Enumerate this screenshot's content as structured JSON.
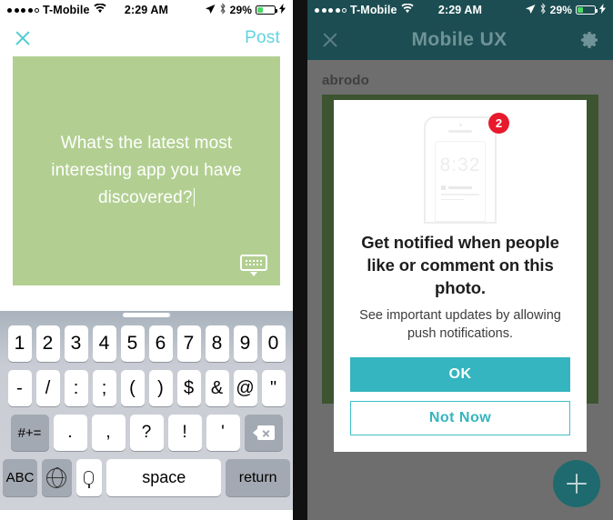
{
  "left_phone": {
    "status_bar": {
      "signal_dots": [
        true,
        true,
        true,
        true,
        false
      ],
      "carrier": "T-Mobile",
      "wifi_icon": "wifi-icon",
      "time": "2:29 AM",
      "location_icon": "location-arrow-icon",
      "bluetooth_icon": "bluetooth-icon",
      "battery_percent": "29%",
      "charging_icon": "charging-bolt-icon"
    },
    "header": {
      "close_icon": "close-x-icon",
      "post_label": "Post"
    },
    "card": {
      "background_color": "#b2cf91",
      "text": "What's the latest most interesting app you have discovered?",
      "keyboard_dismiss_icon": "keyboard-dismiss-icon"
    },
    "keyboard": {
      "row_numbers": [
        "1",
        "2",
        "3",
        "4",
        "5",
        "6",
        "7",
        "8",
        "9",
        "0"
      ],
      "row_symbols": [
        "-",
        "/",
        ":",
        ";",
        "(",
        ")",
        "$",
        "&",
        "@",
        "\""
      ],
      "row_punctuation": [
        ".",
        ",",
        "?",
        "!",
        "'"
      ],
      "more_symbols_label": "#+=",
      "backspace_icon": "backspace-icon",
      "abc_label": "ABC",
      "globe_icon": "globe-icon",
      "mic_icon": "microphone-icon",
      "space_label": "space",
      "return_label": "return"
    }
  },
  "right_phone": {
    "status_bar": {
      "signal_dots": [
        true,
        true,
        true,
        true,
        false
      ],
      "carrier": "T-Mobile",
      "wifi_icon": "wifi-icon",
      "time": "2:29 AM",
      "location_icon": "location-arrow-icon",
      "bluetooth_icon": "bluetooth-icon",
      "battery_percent": "29%",
      "charging_icon": "charging-bolt-icon"
    },
    "header": {
      "close_icon": "close-x-icon",
      "title": "Mobile UX",
      "settings_icon": "gear-icon",
      "background_color": "#1c4d52"
    },
    "background": {
      "username": "abrodo"
    },
    "modal": {
      "illustration": {
        "icon": "phone-notification-illustration",
        "lock_screen_time": "8:32",
        "badge_count": "2",
        "badge_color": "#e8192c"
      },
      "title": "Get notified when people like or comment on this photo.",
      "subtitle": "See important updates by allowing push notifications.",
      "primary_button": "OK",
      "secondary_button": "Not Now",
      "accent_color": "#35b5bf"
    },
    "fab": {
      "icon": "plus-icon",
      "color": "#1f6a6e"
    }
  }
}
